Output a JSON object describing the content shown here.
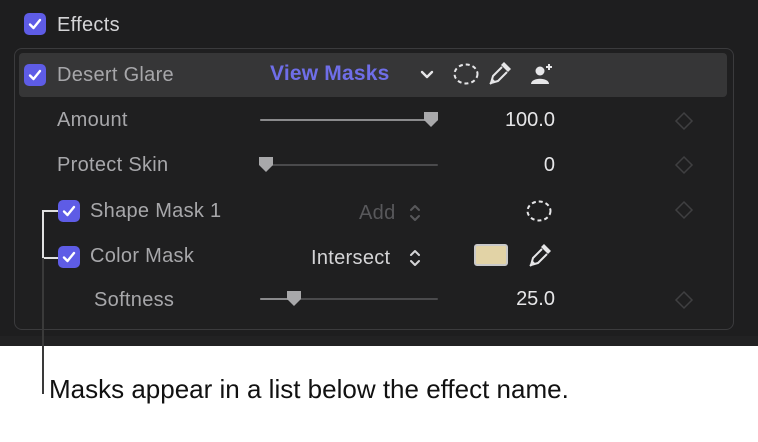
{
  "effects": {
    "section_label": "Effects",
    "section_checked": true
  },
  "effect": {
    "name": "Desert Glare",
    "checked": true,
    "view_masks_label": "View Masks",
    "icons": [
      "chevron-down-icon",
      "shape-mask-icon",
      "color-mask-eyedropper-icon",
      "person-mask-icon"
    ]
  },
  "params": {
    "amount": {
      "label": "Amount",
      "value": "100.0",
      "slider_fraction": 1.0
    },
    "protect_skin": {
      "label": "Protect Skin",
      "value": "0",
      "slider_fraction": 0.0
    },
    "softness": {
      "label": "Softness",
      "value": "25.0",
      "slider_fraction": 0.2
    }
  },
  "masks": {
    "shape_mask": {
      "label": "Shape Mask 1",
      "checked": true,
      "mode": "Add",
      "icon": "shape-mask-icon"
    },
    "color_mask": {
      "label": "Color Mask",
      "checked": true,
      "mode": "Intersect",
      "swatch_color": "#e2d3a6",
      "icon": "eyedropper-icon"
    }
  },
  "callout": {
    "text": "Masks appear in a list below the effect name."
  },
  "colors": {
    "accent": "#5e5ce6",
    "link": "#6f6ee8",
    "panel_bg": "#1e1e1f"
  }
}
